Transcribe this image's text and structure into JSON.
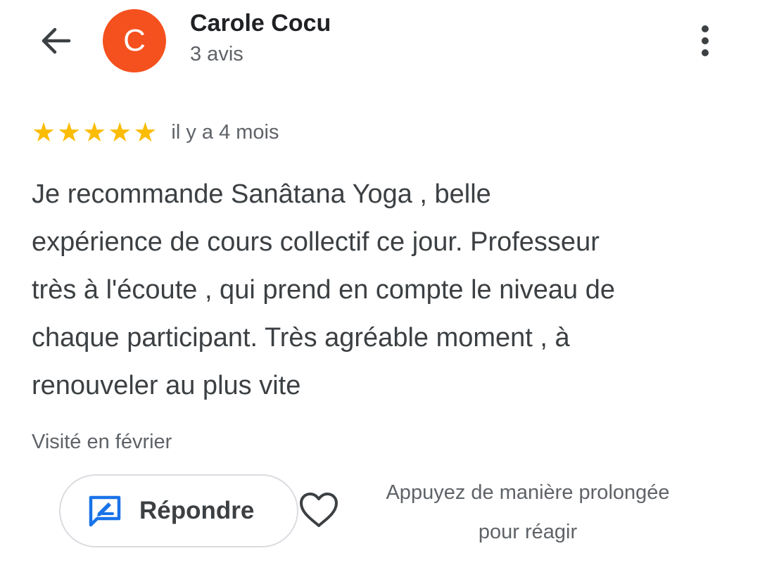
{
  "header": {
    "back_icon": "arrow-left-icon",
    "avatar_letter": "C",
    "avatar_color": "#f4511e",
    "author_name": "Carole Cocu",
    "author_reviews": "3 avis",
    "menu_icon": "more-vert-icon"
  },
  "review": {
    "rating": 5,
    "rating_max": 5,
    "star_glyph": "★",
    "star_color": "#fbbc04",
    "date": "il y a 4 mois",
    "text": "Je recommande Sanâtana Yoga , belle\nexpérience de cours collectif ce jour. Professeur\ntrès à l'écoute , qui prend en compte le niveau de\nchaque participant. Très agréable moment , à\nrenouveler au plus vite",
    "visit": "Visité en février"
  },
  "actions": {
    "reply_label": "Répondre",
    "reply_icon": "reply-comment-icon",
    "reply_icon_color": "#1a73e8",
    "heart_icon": "heart-outline-icon",
    "react_hint": "Appuyez de manière prolongée\npour réagir"
  }
}
